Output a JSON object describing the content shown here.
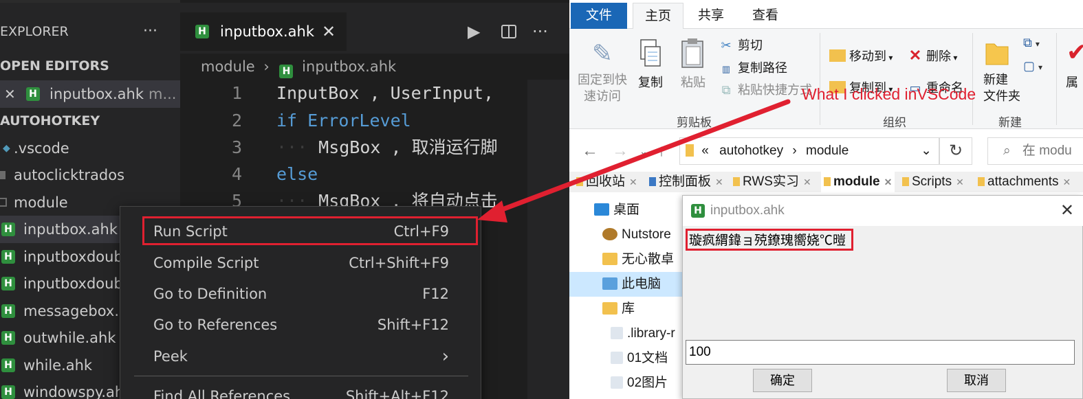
{
  "vscode": {
    "sidebar": {
      "title": "EXPLORER",
      "more": "···",
      "open_editors_header": "OPEN EDITORS",
      "open_editor": {
        "label": "inputbox.ahk",
        "suffix": "m..."
      },
      "workspace_header": "AUTOHOTKEY",
      "items": [
        {
          "label": ".vscode"
        },
        {
          "label": "autoclicktrados"
        },
        {
          "label": "module"
        },
        {
          "label": "inputbox.ahk"
        },
        {
          "label": "inputboxdoub"
        },
        {
          "label": "inputboxdoub"
        },
        {
          "label": "messagebox.a"
        },
        {
          "label": "outwhile.ahk"
        },
        {
          "label": "while.ahk"
        },
        {
          "label": "windowspy.ah"
        }
      ]
    },
    "tab": {
      "label": "inputbox.ahk",
      "close": "✕",
      "icon_letter": "H"
    },
    "actions": {
      "run": "▶",
      "split": "⫴",
      "more": "···"
    },
    "breadcrumb": {
      "folder": "module",
      "separator": "›",
      "file": "inputbox.ahk"
    },
    "code_lines": [
      {
        "num": "1",
        "text": "InputBox , UserInput,"
      },
      {
        "num": "2",
        "kw": "if",
        "text": " ErrorLevel"
      },
      {
        "num": "3",
        "indent": "···",
        "text": "MsgBox , 取消运行脚"
      },
      {
        "num": "4",
        "kw": "else",
        "text": ""
      },
      {
        "num": "5",
        "indent": "···",
        "text": "MsgBox , 将自动点击"
      }
    ],
    "context_menu": [
      {
        "label": "Run Script",
        "shortcut": "Ctrl+F9"
      },
      {
        "label": "Compile Script",
        "shortcut": "Ctrl+Shift+F9"
      },
      {
        "label": "Go to Definition",
        "shortcut": "F12"
      },
      {
        "label": "Go to References",
        "shortcut": "Shift+F12"
      },
      {
        "label": "Peek",
        "shortcut": "›"
      },
      {
        "label": "Find All References",
        "shortcut": "Shift+Alt+F12"
      }
    ]
  },
  "explorer": {
    "ribbon_tabs": [
      "文件",
      "主页",
      "共享",
      "查看"
    ],
    "ribbon": {
      "pin": "固定到快\n速访问",
      "pin_line1": "固定到快",
      "pin_line2": "速访问",
      "copy": "复制",
      "paste": "粘贴",
      "cut": "剪切",
      "copy_path": "复制路径",
      "paste_shortcut": "粘贴快捷方式",
      "clipboard_group": "剪贴板",
      "move_to": "移动到",
      "copy_to": "复制到",
      "delete": "删除",
      "rename": "重命名",
      "organize_group": "组织",
      "new_folder_line1": "新建",
      "new_folder_line2": "文件夹",
      "new_group": "新建",
      "properties": "属"
    },
    "address": {
      "prefix": "«",
      "path1": "autohotkey",
      "sep": "›",
      "path2": "module",
      "search_placeholder": "在 modu"
    },
    "quick_tabs": [
      "回收站",
      "控制面板",
      "RWS实习",
      "module",
      "Scripts",
      "attachments"
    ],
    "nav_items": [
      "桌面",
      "Nutstore",
      "无心散卓",
      "此电脑",
      "库",
      ".library-r",
      "01文档",
      "02图片"
    ],
    "dialog": {
      "title": "inputbox.ahk",
      "prompt": "璇疯緭鍏ョ殑鐐瑰嚮娆℃暟",
      "input_value": "100",
      "ok": "确定",
      "cancel": "取消"
    }
  },
  "annotation": {
    "text": "What I clicked inVSCode",
    "color": "#e02030"
  }
}
